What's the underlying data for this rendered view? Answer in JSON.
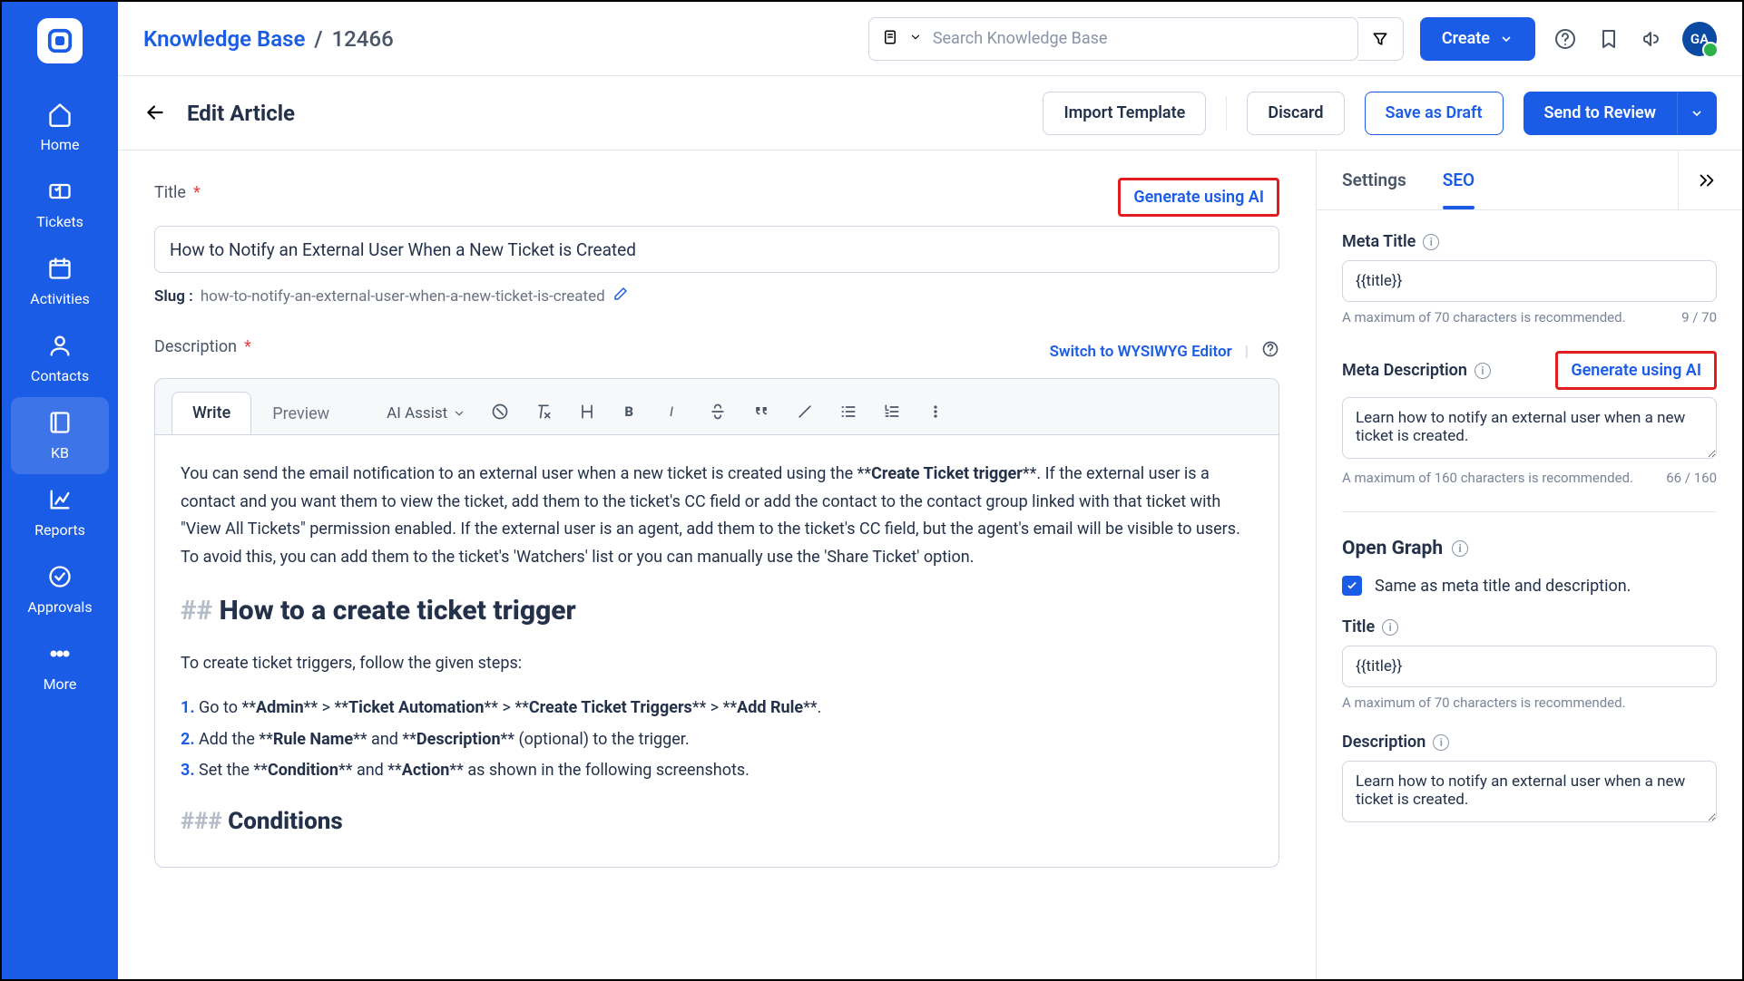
{
  "breadcrumb": {
    "root": "Knowledge Base",
    "id": "12466"
  },
  "search": {
    "placeholder": "Search Knowledge Base"
  },
  "header": {
    "create": "Create",
    "avatar": "GA"
  },
  "sidebar": {
    "items": [
      {
        "label": "Home"
      },
      {
        "label": "Tickets"
      },
      {
        "label": "Activities"
      },
      {
        "label": "Contacts"
      },
      {
        "label": "KB"
      },
      {
        "label": "Reports"
      },
      {
        "label": "Approvals"
      },
      {
        "label": "More"
      }
    ]
  },
  "subheader": {
    "title": "Edit Article",
    "import": "Import Template",
    "discard": "Discard",
    "draft": "Save as Draft",
    "review": "Send to Review"
  },
  "editor": {
    "title_label": "Title",
    "gen_ai": "Generate using AI",
    "title_value": "How to Notify an External User When a New Ticket is Created",
    "slug_label": "Slug :",
    "slug_value": "how-to-notify-an-external-user-when-a-new-ticket-is-created",
    "desc_label": "Description",
    "switch": "Switch to WYSIWYG Editor",
    "tabs": {
      "write": "Write",
      "preview": "Preview"
    },
    "ai_assist": "AI Assist",
    "content": {
      "intro_plain": "You can send the email notification to an external user when a new ticket is created using the **",
      "intro_bold": "Create Ticket trigger",
      "intro_rest": "**. If the external user is a contact and you want them to view the ticket, add them to the ticket's CC field or add the contact to the contact group linked with that ticket with \"View All Tickets\" permission enabled. If the external user is an agent, add them to the ticket's CC field, but the agent's email will be visible to users. To avoid this, you can add them to the ticket's 'Watchers' list or you can manually use the 'Share Ticket' option.",
      "h2_prefix": "## ",
      "h2": "How to a create ticket trigger",
      "steps_intro": "To create ticket triggers, follow the given steps:",
      "li1_a": "Go to **",
      "li1_b": "Admin",
      "li1_c": "** > **",
      "li1_d": "Ticket Automation",
      "li1_e": "** > **",
      "li1_f": "Create Ticket Triggers",
      "li1_g": "** > **",
      "li1_h": "Add Rule",
      "li1_i": "**.",
      "li2_a": "Add the **",
      "li2_b": "Rule Name",
      "li2_c": "** and **",
      "li2_d": "Description",
      "li2_e": "** (optional) to the trigger.",
      "li3_a": "Set the **",
      "li3_b": "Condition",
      "li3_c": "** and **",
      "li3_d": "Action",
      "li3_e": "** as shown in the following screenshots.",
      "h3_prefix": "### ",
      "h3": "Conditions"
    }
  },
  "seo": {
    "tabs": {
      "settings": "Settings",
      "seo": "SEO"
    },
    "meta_title_label": "Meta Title",
    "meta_title_value": "{{title}}",
    "meta_title_hint": "A maximum of 70 characters is recommended.",
    "meta_title_count": "9 / 70",
    "meta_desc_label": "Meta Description",
    "gen_ai": "Generate using AI",
    "meta_desc_value": "Learn how to notify an external user when a new ticket is created.",
    "meta_desc_hint": "A maximum of 160 characters is recommended.",
    "meta_desc_count": "66 / 160",
    "og_title": "Open Graph",
    "og_same": "Same as meta title and description.",
    "og_t_label": "Title",
    "og_t_value": "{{title}}",
    "og_t_hint": "A maximum of 70 characters is recommended.",
    "og_d_label": "Description",
    "og_d_value": "Learn how to notify an external user when a new ticket is created."
  }
}
